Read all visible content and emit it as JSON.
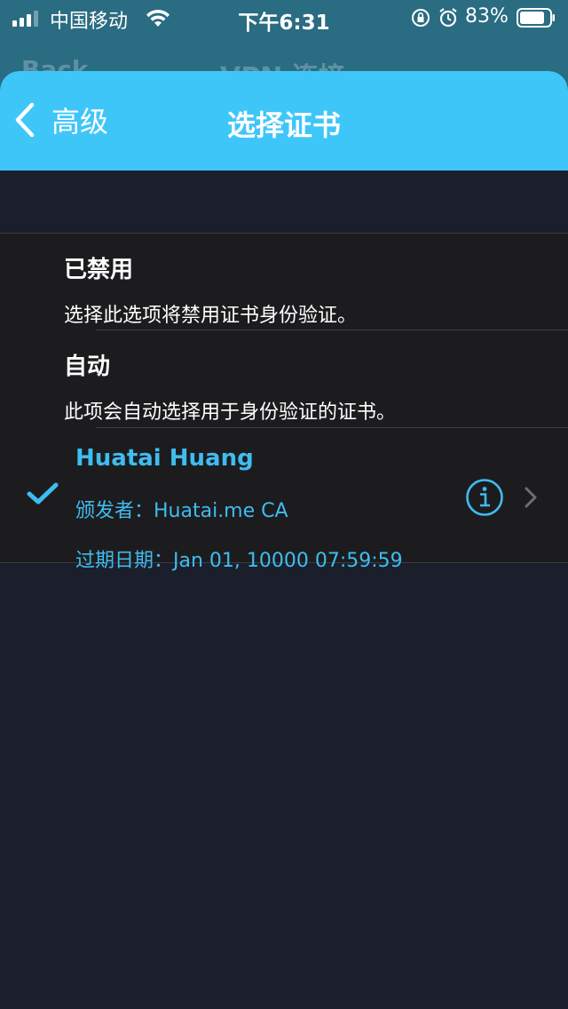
{
  "status_bar": {
    "carrier": "中国移动",
    "time": "下午6:31",
    "battery": "83%",
    "icons": [
      "signal-icon",
      "wifi-icon",
      "orientation-lock-icon",
      "alarm-icon",
      "battery-icon"
    ]
  },
  "underlying": {
    "back_label": "Back",
    "title": "VPN 连接"
  },
  "nav": {
    "back_label": "高级",
    "title": "选择证书"
  },
  "options": [
    {
      "title": "已禁用",
      "description": "选择此选项将禁用证书身份验证。"
    },
    {
      "title": "自动",
      "description": "此项会自动选择用于身份验证的证书。"
    }
  ],
  "certificate": {
    "name": "Huatai Huang",
    "issuer": "颁发者：Huatai.me CA",
    "expiry": "过期日期：Jan 01, 10000 07:59:59",
    "selected": true
  },
  "colors": {
    "nav_bar": "#3fc6f9",
    "accent": "#3fbcf0",
    "background": "#1a1f2b",
    "group_background": "#1c1c1f"
  }
}
